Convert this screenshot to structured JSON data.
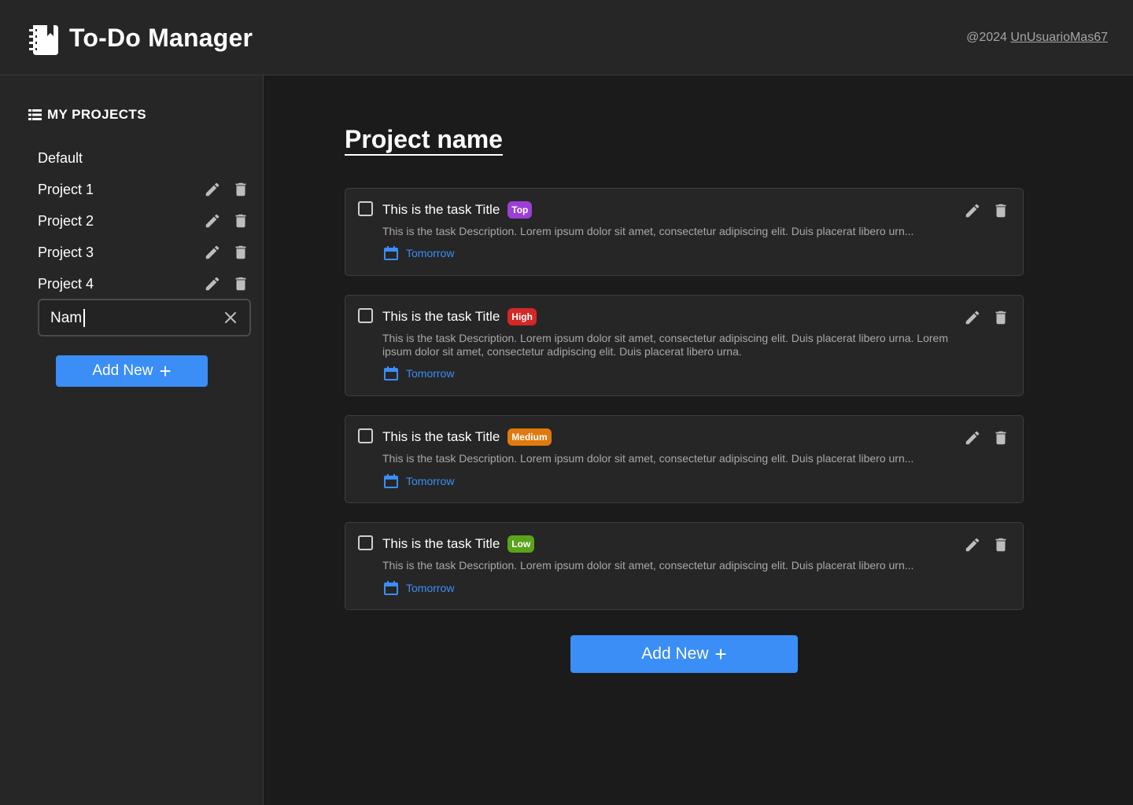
{
  "header": {
    "title": "To-Do Manager",
    "credit_prefix": "@2024",
    "credit_user": "UnUsuarioMas67",
    "logo_icon": "notebook-icon"
  },
  "sidebar": {
    "heading": "MY PROJECTS",
    "heading_icon": "list-icon",
    "projects": [
      {
        "label": "Default"
      },
      {
        "label": "Project 1"
      },
      {
        "label": "Project 2"
      },
      {
        "label": "Project 3"
      },
      {
        "label": "Project 4"
      }
    ],
    "new_project_input": {
      "value": "Nam",
      "placeholder": ""
    },
    "add_label": "Add New"
  },
  "main": {
    "project_title": "Project name",
    "tasks": [
      {
        "title": "This is the task Title",
        "priority": "Top",
        "priority_color": "#9b3fd6",
        "description": "This is the task Description. Lorem ipsum dolor sit amet, consectetur adipiscing elit. Duis placerat libero urn...",
        "due": "Tomorrow"
      },
      {
        "title": "This is the task Title",
        "priority": "High",
        "priority_color": "#d62727",
        "description": "This is the task Description. Lorem ipsum dolor sit amet, consectetur adipiscing elit. Duis placerat libero urna. Lorem ipsum dolor sit amet, consectetur adipiscing elit. Duis placerat libero urna.",
        "due": "Tomorrow"
      },
      {
        "title": "This is the task Title",
        "priority": "Medium",
        "priority_color": "#e07a0e",
        "description": "This is the task Description. Lorem ipsum dolor sit amet, consectetur adipiscing elit. Duis placerat libero urn...",
        "due": "Tomorrow"
      },
      {
        "title": "This is the task Title",
        "priority": "Low",
        "priority_color": "#5aa31a",
        "description": "This is the task Description. Lorem ipsum dolor sit amet, consectetur adipiscing elit. Duis placerat libero urn...",
        "due": "Tomorrow"
      }
    ],
    "add_label": "Add New"
  },
  "colors": {
    "accent": "#3a8ef6",
    "background": "#1b1b1b",
    "panel": "#262626"
  }
}
